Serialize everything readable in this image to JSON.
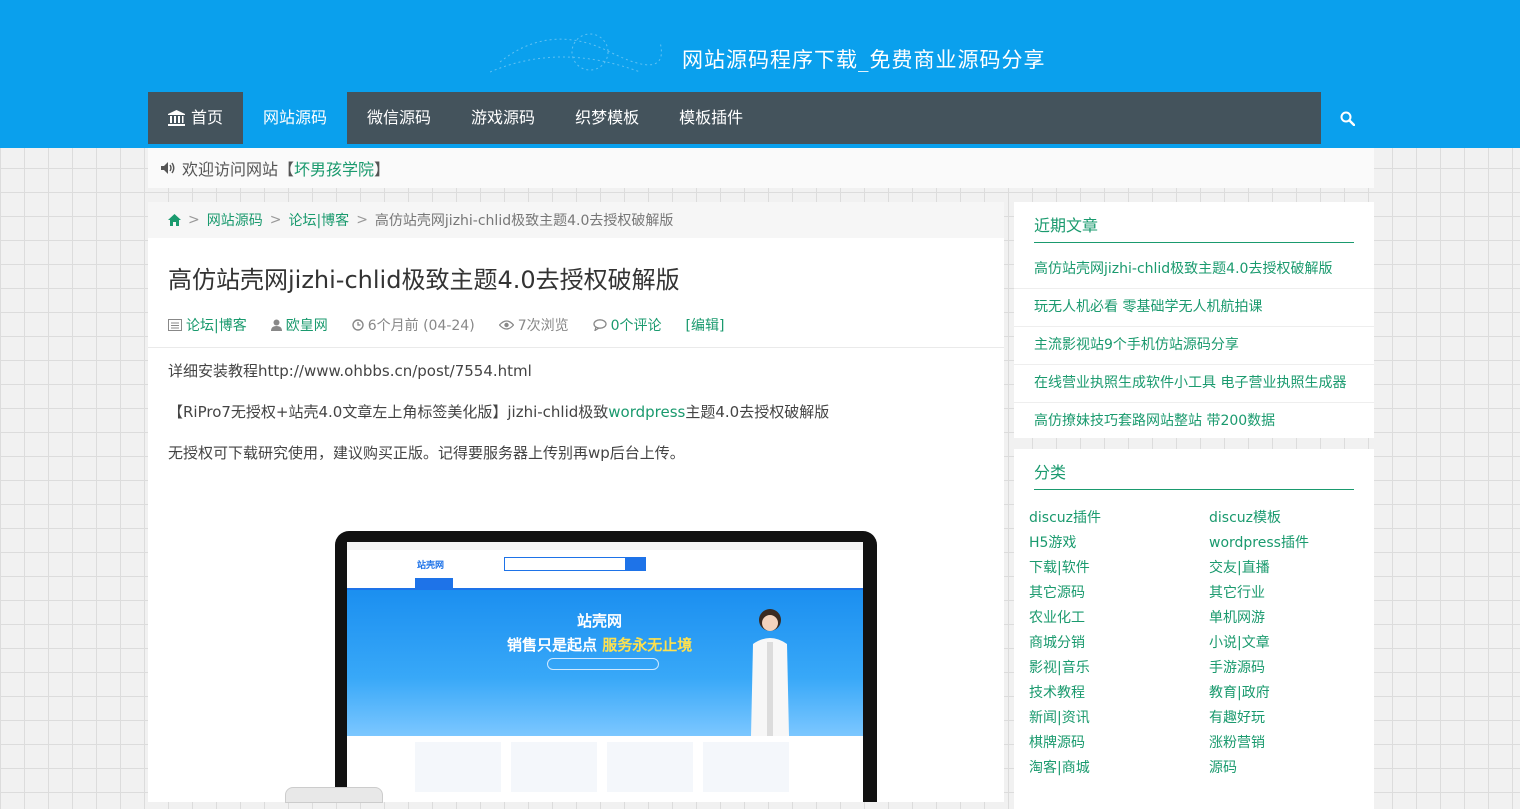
{
  "header": {
    "site_title": "网站源码程序下载_免费商业源码分享"
  },
  "nav": {
    "items": [
      {
        "label": "首页",
        "icon": "bank-icon"
      },
      {
        "label": "网站源码",
        "active": true
      },
      {
        "label": "微信源码"
      },
      {
        "label": "游戏源码"
      },
      {
        "label": "织梦模板"
      },
      {
        "label": "模板插件"
      }
    ],
    "search_icon": "search-icon"
  },
  "notice": {
    "prefix": "欢迎访问网站【",
    "site_name": "坏男孩学院",
    "suffix": "】"
  },
  "breadcrumb": {
    "items": [
      "网站源码",
      "论坛|博客",
      "高仿站壳网jizhi-chlid极致主题4.0去授权破解版"
    ],
    "sep": ">"
  },
  "post": {
    "title": "高仿站壳网jizhi-chlid极致主题4.0去授权破解版",
    "meta": {
      "category": "论坛|博客",
      "author": "欧皇网",
      "time": "6个月前 (04-24)",
      "views": "7次浏览",
      "comments": "0个评论",
      "edit": "[编辑]"
    },
    "paragraphs": {
      "p1": "详细安装教程http://www.ohbbs.cn/post/7554.html",
      "p2_before": "【RiPro7无授权+站壳4.0文章左上角标签美化版】jizhi-chlid极致",
      "p2_link": "wordpress",
      "p2_after": "主题4.0去授权破解版",
      "p3": "无授权可下载研究使用，建议购买正版。记得要服务器上传别再wp后台上传。"
    },
    "image": {
      "brand": "站壳网",
      "slogan_a": "销售只是起点",
      "slogan_b": "服务永无止境",
      "logo": "站壳网"
    }
  },
  "recent": {
    "title": "近期文章",
    "items": [
      "高仿站壳网jizhi-chlid极致主题4.0去授权破解版",
      "玩无人机必看 零基础学无人机航拍课",
      "主流影视站9个手机仿站源码分享",
      "在线营业执照生成软件小工具 电子营业执照生成器",
      "高仿撩妹技巧套路网站整站 带200数据"
    ]
  },
  "categories": {
    "title": "分类",
    "items": [
      "discuz插件",
      "discuz模板",
      "H5游戏",
      "wordpress插件",
      "下载|软件",
      "交友|直播",
      "其它源码",
      "其它行业",
      "农业化工",
      "单机网游",
      "商城分销",
      "小说|文章",
      "影视|音乐",
      "手游源码",
      "技术教程",
      "教育|政府",
      "新闻|资讯",
      "有趣好玩",
      "棋牌源码",
      "涨粉营销",
      "淘客|商城",
      "源码"
    ]
  },
  "colors": {
    "primary": "#0aa0ed",
    "nav_dark": "#44535c",
    "link": "#1a9a6e"
  }
}
